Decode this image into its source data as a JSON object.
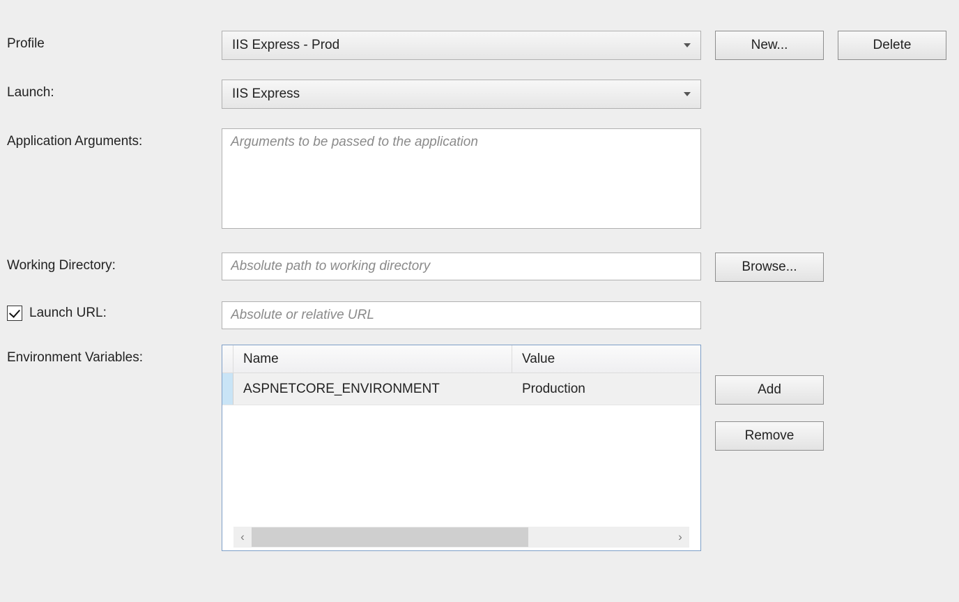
{
  "labels": {
    "profile": "Profile",
    "launch": "Launch:",
    "app_args": "Application Arguments:",
    "working_dir": "Working Directory:",
    "launch_url": "Launch URL:",
    "env_vars": "Environment Variables:"
  },
  "profile": {
    "selected": "IIS Express - Prod"
  },
  "launch": {
    "selected": "IIS Express"
  },
  "app_args": {
    "placeholder": "Arguments to be passed to the application",
    "value": ""
  },
  "working_dir": {
    "placeholder": "Absolute path to working directory",
    "value": ""
  },
  "launch_url": {
    "checked": true,
    "placeholder": "Absolute or relative URL",
    "value": ""
  },
  "env_grid": {
    "headers": {
      "name": "Name",
      "value": "Value"
    },
    "rows": [
      {
        "name": "ASPNETCORE_ENVIRONMENT",
        "value": "Production"
      }
    ]
  },
  "buttons": {
    "new": "New...",
    "delete": "Delete",
    "browse": "Browse...",
    "add": "Add",
    "remove": "Remove"
  }
}
